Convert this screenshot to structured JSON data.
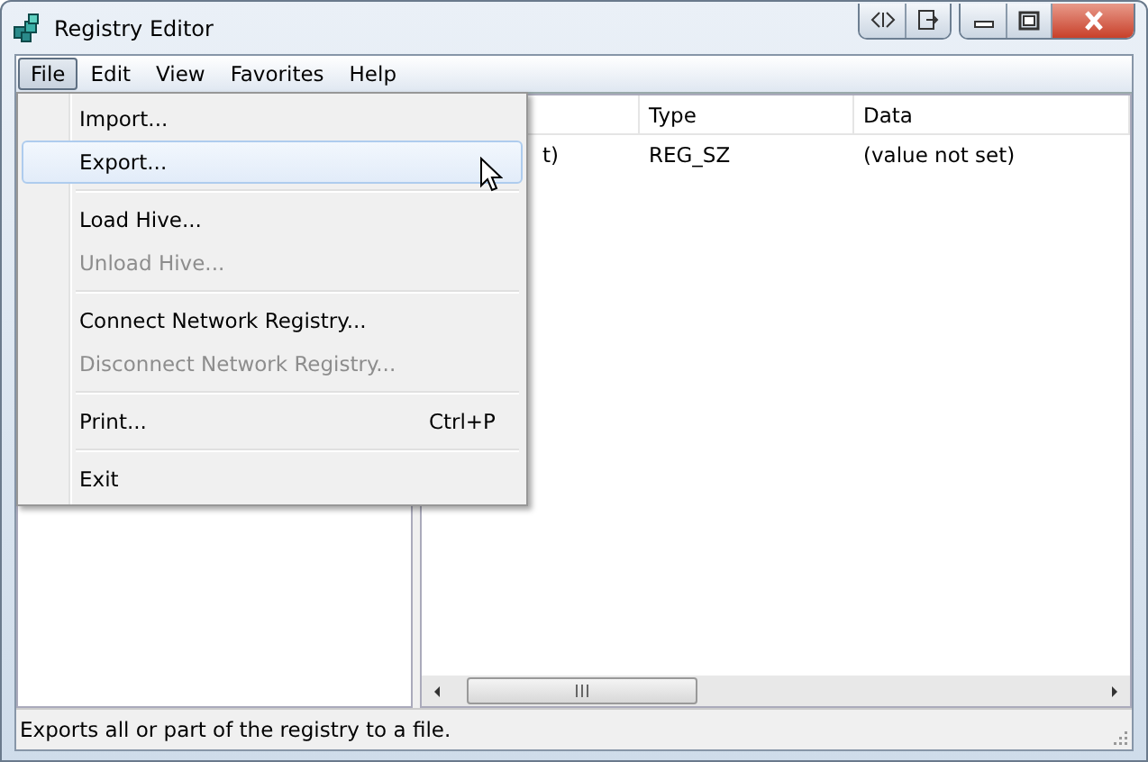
{
  "window": {
    "title": "Registry Editor"
  },
  "menu_bar": [
    {
      "label": "File",
      "selected": true
    },
    {
      "label": "Edit",
      "selected": false
    },
    {
      "label": "View",
      "selected": false
    },
    {
      "label": "Favorites",
      "selected": false
    },
    {
      "label": "Help",
      "selected": false
    }
  ],
  "file_menu": [
    {
      "kind": "item",
      "label": "Import...",
      "selected": false,
      "disabled": false
    },
    {
      "kind": "item",
      "label": "Export...",
      "selected": true,
      "disabled": false
    },
    {
      "kind": "separator"
    },
    {
      "kind": "item",
      "label": "Load Hive...",
      "selected": false,
      "disabled": false
    },
    {
      "kind": "item",
      "label": "Unload Hive...",
      "selected": false,
      "disabled": true
    },
    {
      "kind": "separator"
    },
    {
      "kind": "item",
      "label": "Connect Network Registry...",
      "selected": false,
      "disabled": false
    },
    {
      "kind": "item",
      "label": "Disconnect Network Registry...",
      "selected": false,
      "disabled": true
    },
    {
      "kind": "separator"
    },
    {
      "kind": "item",
      "label": "Print...",
      "shortcut": "Ctrl+P",
      "selected": false,
      "disabled": false
    },
    {
      "kind": "separator"
    },
    {
      "kind": "item",
      "label": "Exit",
      "selected": false,
      "disabled": false
    }
  ],
  "values_table": {
    "columns": [
      "Type",
      "Data"
    ],
    "rows": [
      {
        "column_1": "t)",
        "type": "REG_SZ",
        "data": "(value not set)"
      }
    ]
  },
  "status_bar": "Exports all or part of the registry to a file."
}
